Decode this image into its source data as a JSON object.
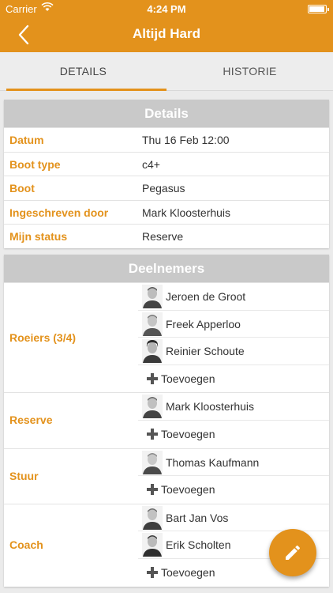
{
  "status_bar": {
    "carrier": "Carrier",
    "time": "4:24 PM"
  },
  "nav": {
    "title": "Altijd Hard"
  },
  "tabs": [
    {
      "label": "DETAILS"
    },
    {
      "label": "HISTORIE"
    }
  ],
  "details": {
    "header": "Details",
    "rows": [
      {
        "label": "Datum",
        "value": "Thu 16 Feb 12:00"
      },
      {
        "label": "Boot type",
        "value": "c4+"
      },
      {
        "label": "Boot",
        "value": "Pegasus"
      },
      {
        "label": "Ingeschreven door",
        "value": "Mark Kloosterhuis"
      },
      {
        "label": "Mijn status",
        "value": "Reserve"
      }
    ]
  },
  "participants": {
    "header": "Deelnemers",
    "add_label": "Toevoegen",
    "groups": [
      {
        "label": "Roeiers (3/4)",
        "members": [
          "Jeroen de Groot",
          "Freek Apperloo",
          "Reinier Schoute"
        ]
      },
      {
        "label": "Reserve",
        "members": [
          "Mark Kloosterhuis"
        ]
      },
      {
        "label": "Stuur",
        "members": [
          "Thomas Kaufmann"
        ]
      },
      {
        "label": "Coach",
        "members": [
          "Bart Jan Vos",
          "Erik Scholten"
        ]
      }
    ]
  },
  "colors": {
    "accent": "#e3921c",
    "header_gray": "#c9c9c9",
    "background": "#ebebeb"
  },
  "icons": {
    "back": "chevron-left-icon",
    "add": "plus-icon",
    "fab": "pencil-icon"
  }
}
